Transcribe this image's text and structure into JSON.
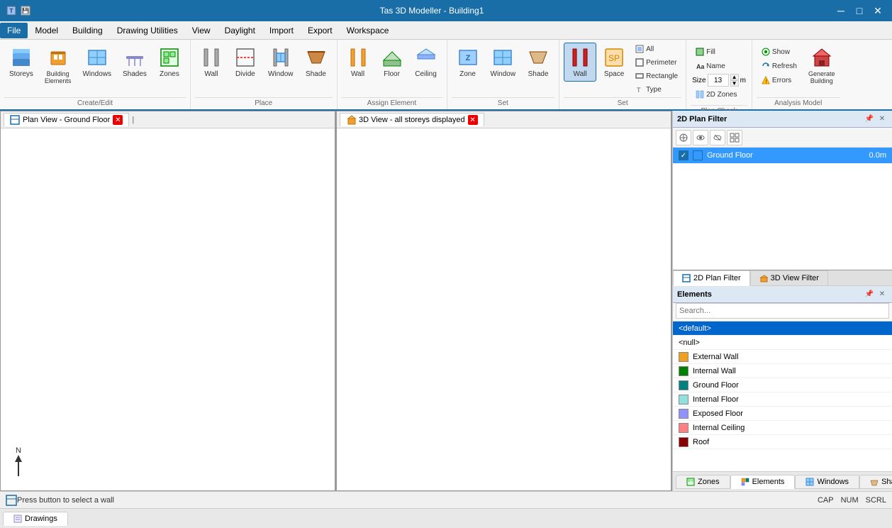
{
  "app": {
    "title": "Tas 3D Modeller - Building1",
    "title_icon": "building-icon"
  },
  "menu": {
    "items": [
      {
        "id": "file",
        "label": "File",
        "active": true
      },
      {
        "id": "model",
        "label": "Model"
      },
      {
        "id": "building",
        "label": "Building"
      },
      {
        "id": "drawing_utilities",
        "label": "Drawing Utilities"
      },
      {
        "id": "view",
        "label": "View"
      },
      {
        "id": "daylight",
        "label": "Daylight"
      },
      {
        "id": "import",
        "label": "Import"
      },
      {
        "id": "export",
        "label": "Export"
      },
      {
        "id": "workspace",
        "label": "Workspace"
      }
    ]
  },
  "ribbon": {
    "groups": [
      {
        "id": "create_edit",
        "label": "Create/Edit",
        "buttons": [
          {
            "id": "storeys",
            "label": "Storeys",
            "icon": "storeys-icon"
          },
          {
            "id": "building_elements",
            "label": "Building\nElements",
            "icon": "building-elements-icon"
          },
          {
            "id": "windows",
            "label": "Windows",
            "icon": "windows-icon"
          },
          {
            "id": "shades",
            "label": "Shades",
            "icon": "shades-icon"
          },
          {
            "id": "zones",
            "label": "Zones",
            "icon": "zones-icon"
          }
        ]
      },
      {
        "id": "place",
        "label": "Place",
        "buttons": [
          {
            "id": "wall_place",
            "label": "Wall",
            "icon": "wall-icon"
          },
          {
            "id": "divide",
            "label": "Divide",
            "icon": "divide-icon"
          },
          {
            "id": "window_place",
            "label": "Window",
            "icon": "window-icon"
          },
          {
            "id": "shade_place",
            "label": "Shade",
            "icon": "shade-icon"
          }
        ]
      },
      {
        "id": "assign_element",
        "label": "Assign Element",
        "buttons": [
          {
            "id": "wall_assign",
            "label": "Wall",
            "icon": "wall-assign-icon"
          },
          {
            "id": "floor_assign",
            "label": "Floor",
            "icon": "floor-assign-icon"
          },
          {
            "id": "ceiling_assign",
            "label": "Ceiling",
            "icon": "ceiling-assign-icon"
          }
        ]
      },
      {
        "id": "set",
        "label": "Set",
        "buttons": [
          {
            "id": "zone_set",
            "label": "Zone",
            "icon": "zone-icon"
          },
          {
            "id": "window_set",
            "label": "Window",
            "icon": "window-set-icon"
          },
          {
            "id": "shade_set",
            "label": "Shade",
            "icon": "shade-set-icon"
          }
        ]
      },
      {
        "id": "set2",
        "label": "Set",
        "active_buttons": [
          {
            "id": "wall_active",
            "label": "Wall",
            "icon": "wall-red-icon",
            "active": true
          },
          {
            "id": "space_active",
            "label": "Space",
            "icon": "space-icon"
          }
        ],
        "small_buttons": [
          {
            "id": "all",
            "label": "All"
          },
          {
            "id": "perimeter",
            "label": "Perimeter"
          },
          {
            "id": "rectangle",
            "label": "Rectangle"
          },
          {
            "id": "type",
            "label": "Type"
          }
        ]
      },
      {
        "id": "plan_check",
        "label": "Plan Check",
        "sub_buttons": [
          {
            "id": "fill",
            "label": "Fill"
          },
          {
            "id": "name",
            "label": "Name"
          },
          {
            "id": "size_label",
            "label": "Size"
          },
          {
            "id": "size_value",
            "value": "13"
          },
          {
            "id": "size_unit",
            "label": "m"
          },
          {
            "id": "2d_zones",
            "label": "2D Zones"
          }
        ]
      },
      {
        "id": "analysis_model",
        "label": "Analysis Model",
        "buttons": [
          {
            "id": "show",
            "label": "Show"
          },
          {
            "id": "refresh",
            "label": "Refresh"
          },
          {
            "id": "errors",
            "label": "Errors"
          },
          {
            "id": "generate_building",
            "label": "Generate\nBuilding",
            "icon": "generate-icon"
          }
        ]
      }
    ]
  },
  "viewports": [
    {
      "id": "plan_view",
      "tab_label": "Plan View - Ground Floor",
      "tab_icon": "plan-view-icon",
      "content": ""
    },
    {
      "id": "3d_view",
      "tab_label": "3D View - all storeys displayed",
      "tab_icon": "3d-view-icon",
      "content": ""
    }
  ],
  "right_panel": {
    "plan_filter": {
      "title": "2D Plan Filter",
      "toolbar_icons": [
        "search-icon",
        "zoom-icon",
        "settings-icon",
        "table-icon"
      ],
      "floors": [
        {
          "id": "ground",
          "label": "Ground Floor",
          "value": "0.0m",
          "color": "#3399ff",
          "checked": true
        }
      ]
    },
    "tabs": [
      {
        "id": "2d_plan_filter",
        "label": "2D Plan Filter",
        "icon": "filter-icon",
        "active": true
      },
      {
        "id": "3d_view_filter",
        "label": "3D View Filter",
        "icon": "cube-icon"
      }
    ],
    "elements": {
      "title": "Elements",
      "search_placeholder": "Search...",
      "items": [
        {
          "id": "default",
          "label": "<default>",
          "color": null,
          "selected": true
        },
        {
          "id": "null",
          "label": "<null>",
          "color": null
        },
        {
          "id": "external_wall",
          "label": "External Wall",
          "color": "#f0a020"
        },
        {
          "id": "internal_wall",
          "label": "Internal Wall",
          "color": "#008000"
        },
        {
          "id": "ground_floor",
          "label": "Ground Floor",
          "color": "#008080"
        },
        {
          "id": "internal_floor",
          "label": "Internal Floor",
          "color": "#90e0e0"
        },
        {
          "id": "exposed_floor",
          "label": "Exposed Floor",
          "color": "#9090ff"
        },
        {
          "id": "internal_ceiling",
          "label": "Internal Ceiling",
          "color": "#ff8080"
        },
        {
          "id": "roof",
          "label": "Roof",
          "color": "#880000"
        }
      ]
    },
    "bottom_tabs": [
      {
        "id": "zones",
        "label": "Zones",
        "icon": "zones-tab-icon"
      },
      {
        "id": "elements",
        "label": "Elements",
        "icon": "elements-tab-icon",
        "active": true
      },
      {
        "id": "windows",
        "label": "Windows",
        "icon": "windows-tab-icon"
      },
      {
        "id": "shades",
        "label": "Shades",
        "icon": "shades-tab-icon"
      }
    ]
  },
  "status_bar": {
    "message": "Press button to select a wall",
    "cap": "CAP",
    "num": "NUM",
    "scrl": "SCRL"
  },
  "north_arrow": {
    "label": "N"
  }
}
